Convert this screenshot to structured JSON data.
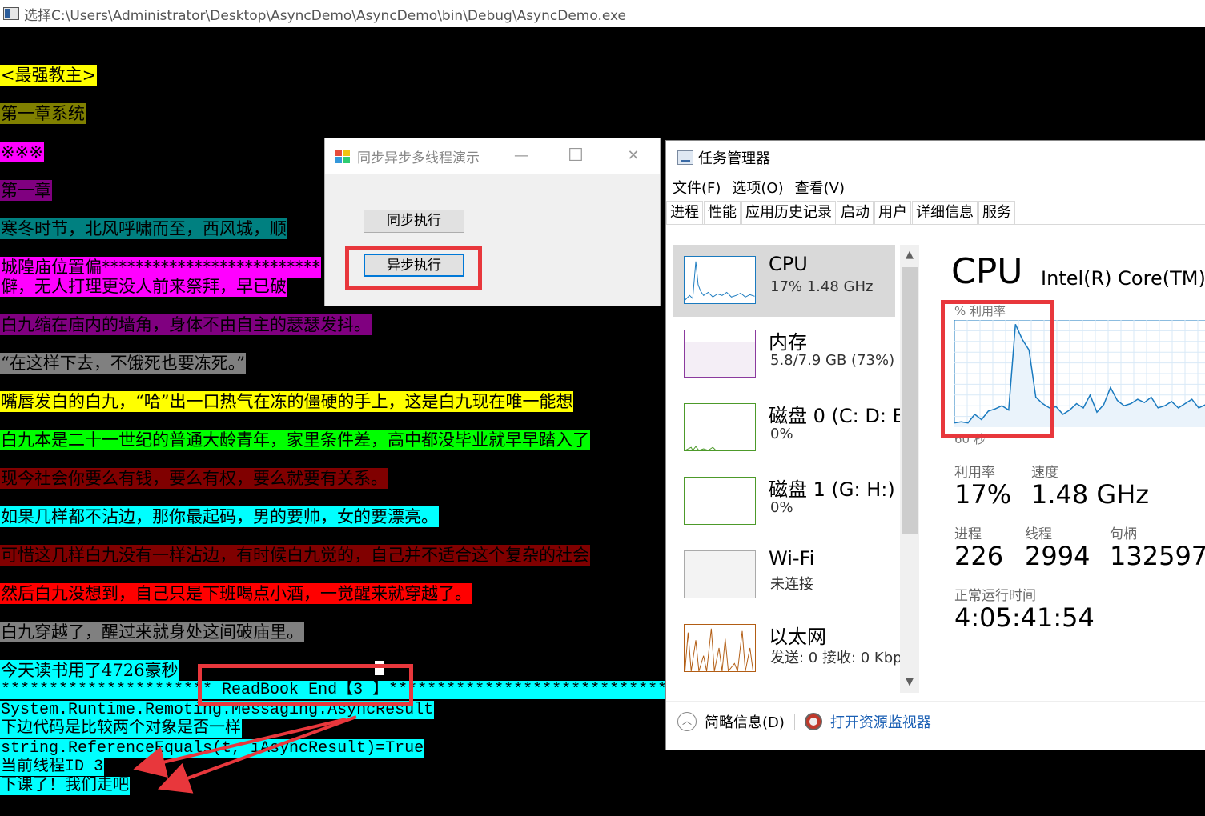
{
  "console": {
    "title": "选择C:\\Users\\Administrator\\Desktop\\AsyncDemo\\AsyncDemo\\bin\\Debug\\AsyncDemo.exe",
    "lines": [
      {
        "text": "<最强教主>",
        "color": "#000000",
        "bg": "#ffff00"
      },
      {
        "text": "第一章系统",
        "color": "#000000",
        "bg": "#808000"
      },
      {
        "text": "※※※",
        "color": "#000000",
        "bg": "#ff00ff"
      },
      {
        "text": "第一章",
        "color": "#000000",
        "bg": "#800080"
      },
      {
        "text": "寒冬时节，北风呼啸而至，西风城，顺",
        "color": "#000000",
        "bg": "#008080"
      },
      {
        "text": "城隍庙位置偏**************************",
        "color": "#000000",
        "bg": "#ff00ff"
      },
      {
        "text": "僻，无人打理更没人前来祭拜，早已破",
        "color": "#000000",
        "bg": "#ff00ff"
      },
      {
        "text": "白九缩在庙内的墙角，身体不由自主的瑟瑟发抖。",
        "color": "#000000",
        "bg": "#800080"
      },
      {
        "text": "“在这样下去，不饿死也要冻死。”",
        "color": "#000000",
        "bg": "#808080"
      },
      {
        "text": "嘴唇发白的白九，“哈”出一口热气在冻的僵硬的手上，这是白九现在唯一能想",
        "color": "#000000",
        "bg": "#ffff00"
      },
      {
        "text": "白九本是二十一世纪的普通大龄青年，家里条件差，高中都没毕业就早早踏入了",
        "color": "#000000",
        "bg": "#00ff00"
      },
      {
        "text": "现今社会你要么有钱，要么有权，要么就要有关系。",
        "color": "#000000",
        "bg": "#800000"
      },
      {
        "text": "如果几样都不沾边，那你最起码，男的要帅，女的要漂亮。",
        "color": "#000000",
        "bg": "#00ffff"
      },
      {
        "text": "可惜这几样白九没有一样沾边，有时候白九觉的，自己并不适合这个复杂的社会",
        "color": "#000000",
        "bg": "#800000"
      },
      {
        "text": "然后白九没想到，自己只是下班喝点小酒，一觉醒来就穿越了。",
        "color": "#000000",
        "bg": "#ff0000"
      },
      {
        "text": "白九穿越了，醒过来就身处这间破庙里。",
        "color": "#000000",
        "bg": "#808080"
      },
      {
        "text": "今天读书用了4726豪秒",
        "color": "#000000",
        "bg": "#00ffff"
      }
    ],
    "mono_lines": [
      {
        "text": "********************** ReadBook End【3 】*************************************",
        "color": "#000000",
        "bg": "#00ffff"
      },
      {
        "text": "System.Runtime.Remoting.Messaging.AsyncResult",
        "color": "#000000",
        "bg": "#00ffff"
      },
      {
        "text": "下边代码是比较两个对象是否一样",
        "color": "#000000",
        "bg": "#00ffff"
      },
      {
        "text": "string.ReferenceEquals(t, iAsyncResult)=True",
        "color": "#000000",
        "bg": "#00ffff"
      },
      {
        "text": "当前线程ID 3",
        "color": "#000000",
        "bg": "#00ffff"
      },
      {
        "text": "下课了！我们走吧",
        "color": "#000000",
        "bg": "#00ffff"
      }
    ]
  },
  "form": {
    "title": "同步异步多线程演示",
    "minimize": "—",
    "maximize": "☐",
    "close": "✕",
    "sync_button": "同步执行",
    "async_button": "异步执行"
  },
  "taskmgr": {
    "title": "任务管理器",
    "menu": [
      "文件(F)",
      "选项(O)",
      "查看(V)"
    ],
    "tabs": [
      "进程",
      "性能",
      "应用历史记录",
      "启动",
      "用户",
      "详细信息",
      "服务"
    ],
    "items": [
      {
        "name": "CPU",
        "value": "17%  1.48 GHz"
      },
      {
        "name": "内存",
        "value": "5.8/7.9 GB (73%)"
      },
      {
        "name": "磁盘 0 (C: D: E:",
        "value": "0%"
      },
      {
        "name": "磁盘 1 (G: H:)",
        "value": "0%"
      },
      {
        "name": "Wi-Fi",
        "value": "未连接"
      },
      {
        "name": "以太网",
        "value": "发送: 0 接收: 0 Kbp"
      }
    ],
    "detail": {
      "title": "CPU",
      "cpu_name": "Intel(R) Core(TM)",
      "graph_label": "% 利用率",
      "graph_time": "60 秒",
      "util_label": "利用率",
      "util_value": "17%",
      "speed_label": "速度",
      "speed_value": "1.48 GHz",
      "proc_label": "进程",
      "proc_value": "226",
      "thread_label": "线程",
      "thread_value": "2994",
      "handle_label": "句柄",
      "handle_value": "132597",
      "uptime_label": "正常运行时间",
      "uptime_value": "4:05:41:54"
    },
    "footer": {
      "summary": "简略信息(D)",
      "resmon": "打开资源监视器"
    },
    "cpu_history": [
      4,
      5,
      4,
      12,
      7,
      15,
      17,
      20,
      16,
      96,
      82,
      72,
      28,
      22,
      18,
      19,
      12,
      16,
      22,
      18,
      30,
      14,
      21,
      37,
      25,
      20,
      22,
      26,
      23,
      28,
      18,
      20,
      24,
      18,
      22,
      26,
      18,
      21
    ]
  },
  "colors": {
    "accent": "#0078d7",
    "highlight_box": "#e8373c",
    "link": "#1a5fb4"
  }
}
